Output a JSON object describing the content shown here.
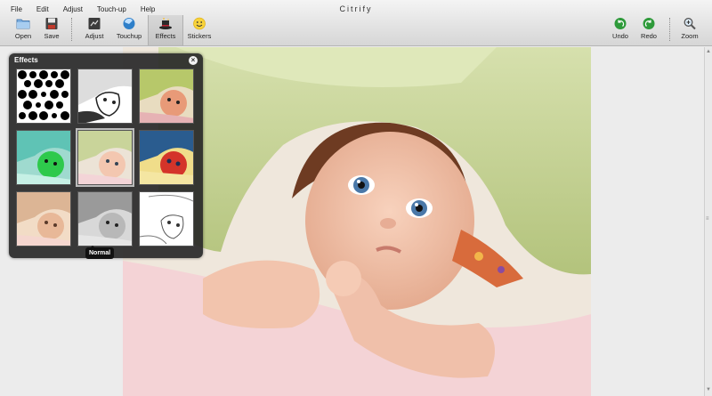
{
  "app": {
    "title": "Citrify"
  },
  "menu": [
    "File",
    "Edit",
    "Adjust",
    "Touch-up",
    "Help"
  ],
  "toolbar": {
    "open": "Open",
    "save": "Save",
    "adjust": "Adjust",
    "touchup": "Touchup",
    "effects": "Effects",
    "stickers": "Stickers",
    "undo": "Undo",
    "redo": "Redo",
    "zoom": "Zoom"
  },
  "effects_panel": {
    "title": "Effects",
    "close_glyph": "×",
    "tooltip": "Normal",
    "thumbnails": [
      "halftone",
      "sketch",
      "warm-color",
      "green-tint",
      "normal",
      "pop-art",
      "sepia",
      "grayscale",
      "pencil"
    ]
  },
  "colors": {
    "accent_green": "#2e9a3a",
    "panel_bg": "#282828"
  }
}
